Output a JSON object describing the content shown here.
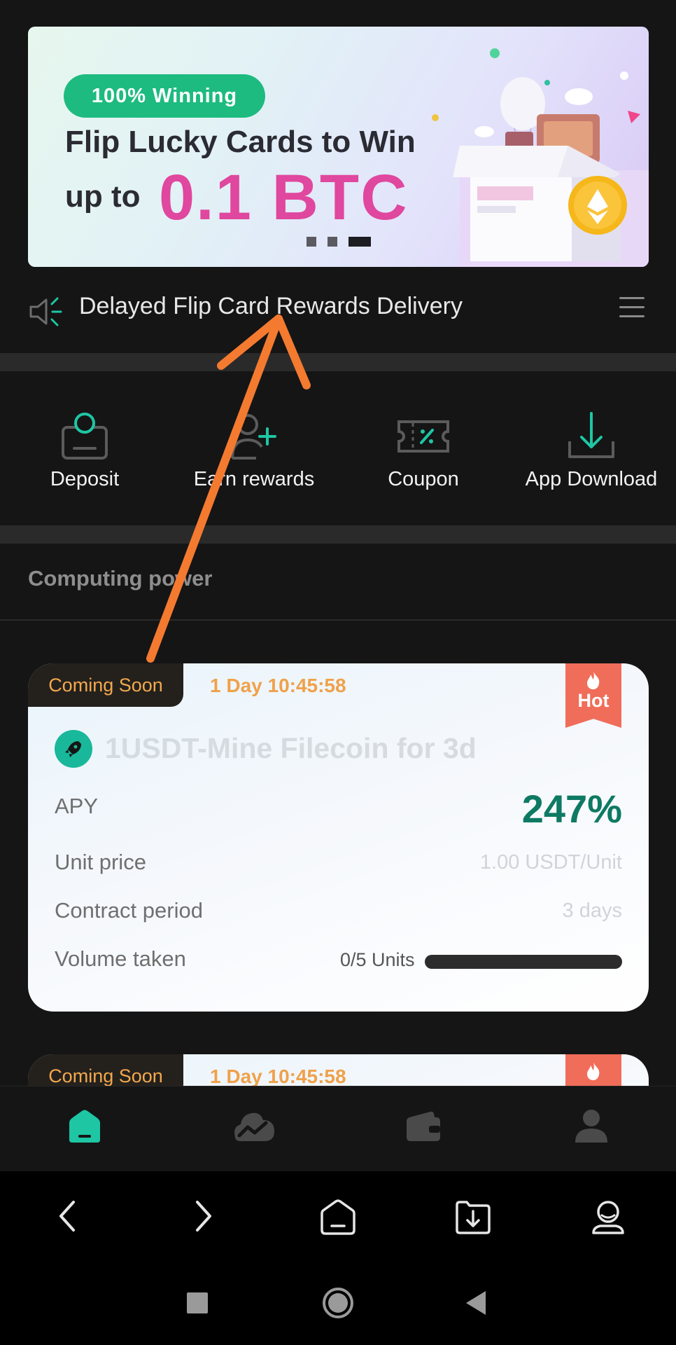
{
  "banner": {
    "badge": "100% Winning",
    "line1": "Flip Lucky Cards to Win",
    "line2_prefix": "up to",
    "line2_highlight": "0.1 BTC",
    "carousel_pages": 3,
    "carousel_active": 3,
    "colors": {
      "badge": "#1dbb7f",
      "highlight": "#e0479e"
    }
  },
  "notice": {
    "text": "Delayed Flip Card Rewards Delivery",
    "icon": "speaker-icon",
    "menu_icon": "menu-icon"
  },
  "actions": [
    {
      "label": "Deposit",
      "icon": "deposit-icon"
    },
    {
      "label": "Earn rewards",
      "icon": "add-user-icon"
    },
    {
      "label": "Coupon",
      "icon": "coupon-icon"
    },
    {
      "label": "App Download",
      "icon": "download-icon"
    }
  ],
  "section": {
    "title": "Computing power"
  },
  "products": [
    {
      "status": "Coming Soon",
      "countdown": "1 Day 10:45:58",
      "hot_label": "Hot",
      "title": "1USDT-Mine Filecoin for 3d",
      "apy_label": "APY",
      "apy_value": "247%",
      "unit_price_label": "Unit price",
      "unit_price_value": "1.00 USDT/Unit",
      "period_label": "Contract period",
      "period_value": "3 days",
      "volume_label": "Volume taken",
      "volume_value": "0/5 Units",
      "volume_fraction": 0
    },
    {
      "status": "Coming Soon",
      "countdown": "1 Day 10:45:58"
    }
  ],
  "tabbar": [
    {
      "icon": "home-icon",
      "active": true
    },
    {
      "icon": "market-icon",
      "active": false
    },
    {
      "icon": "wallet-icon",
      "active": false
    },
    {
      "icon": "profile-icon",
      "active": false
    }
  ],
  "browser": [
    {
      "icon": "back-icon"
    },
    {
      "icon": "forward-icon"
    },
    {
      "icon": "home-icon"
    },
    {
      "icon": "downloads-icon"
    },
    {
      "icon": "account-icon"
    }
  ],
  "system_nav": [
    {
      "icon": "recents-icon"
    },
    {
      "icon": "home-circle-icon"
    },
    {
      "icon": "back-triangle-icon"
    }
  ],
  "colors": {
    "accent": "#1ec6a4",
    "background": "#151515",
    "annotation_arrow": "#f47a30"
  }
}
